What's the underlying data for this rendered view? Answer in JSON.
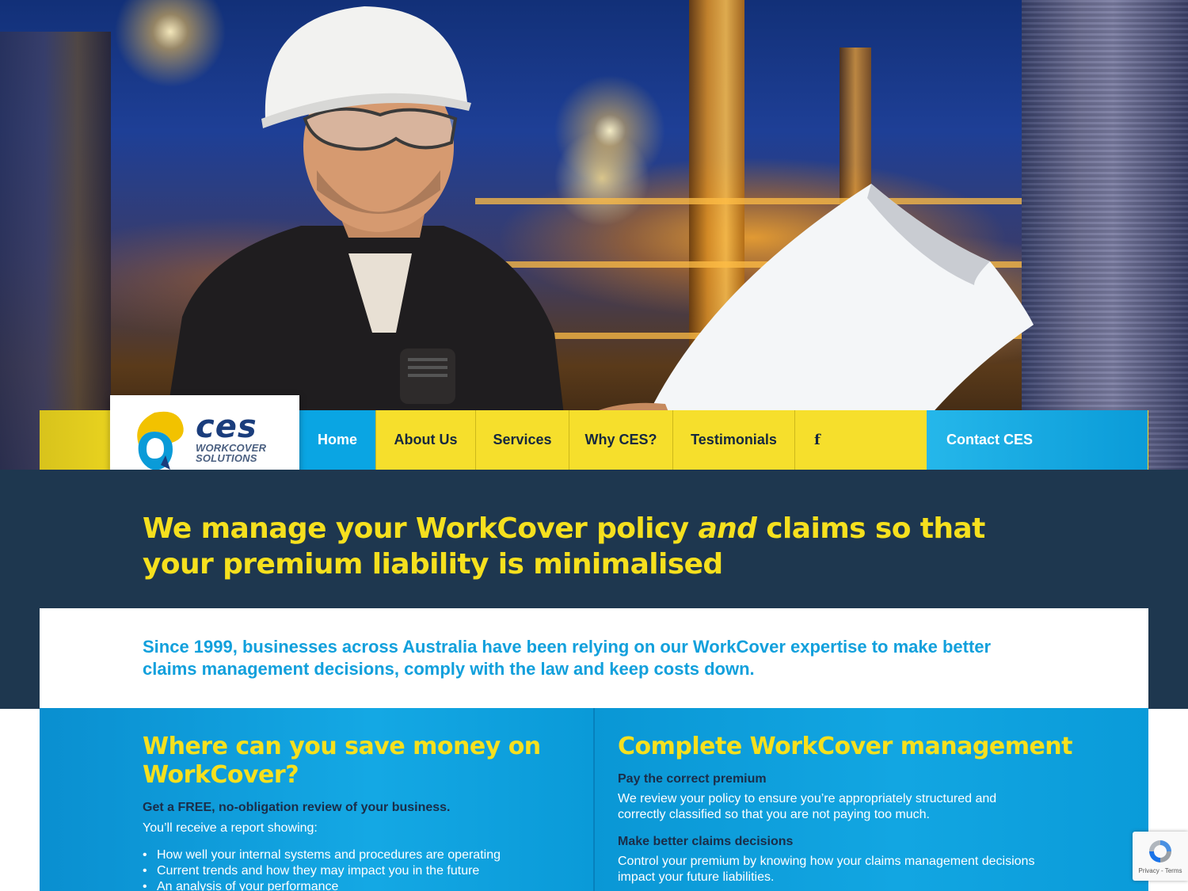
{
  "brand": {
    "name": "ces",
    "tagline_line1": "WORKCOVER",
    "tagline_line2": "SOLUTIONS",
    "colors": {
      "yellow": "#f6e01e",
      "blue": "#0aa5e3",
      "navy": "#1e374f",
      "dark_text": "#16283f"
    }
  },
  "nav": {
    "items": [
      {
        "label": "Home",
        "active": true
      },
      {
        "label": "About Us"
      },
      {
        "label": "Services"
      },
      {
        "label": "Why CES?"
      },
      {
        "label": "Testimonials"
      }
    ],
    "facebook_icon": "facebook-icon",
    "facebook_glyph": "f",
    "contact_label": "Contact CES"
  },
  "hero": {
    "headline_part1": "We manage your WorkCover policy ",
    "headline_emphasis": "and",
    "headline_part2": " claims so that your premium liability is minimalised"
  },
  "intro": {
    "text": "Since 1999, businesses across Australia have been relying on our WorkCover expertise to make better claims management decisions, comply with the law and keep costs down."
  },
  "left_column": {
    "title": "Where can you save money on WorkCover?",
    "subtitle": "Get a FREE, no-obligation review of your business.",
    "text": "You’ll receive a report showing:",
    "bullets": [
      "How well your internal systems and procedures are operating",
      "Current trends and how they may impact you in the future",
      "An analysis of your performance"
    ]
  },
  "right_column": {
    "title": "Complete WorkCover management",
    "sections": [
      {
        "heading": "Pay the correct premium",
        "text": "We review your policy to ensure you’re appropriately structured and correctly classified so that you are not paying too much."
      },
      {
        "heading": "Make better claims decisions",
        "text": "Control your premium by knowing how your claims management decisions impact your future liabilities."
      }
    ]
  },
  "recaptcha": {
    "label": "Privacy - Terms",
    "icon": "recaptcha-icon"
  }
}
